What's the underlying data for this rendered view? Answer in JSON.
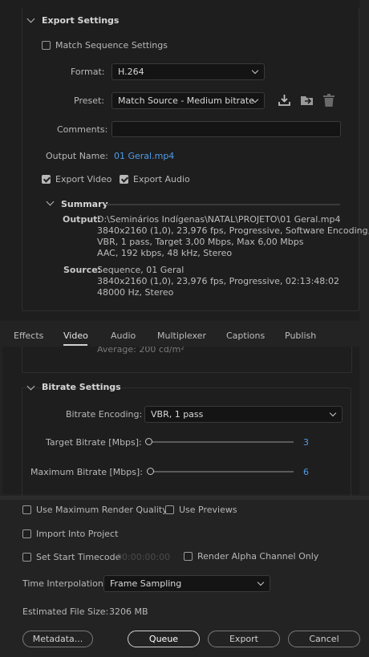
{
  "export_settings": {
    "header": "Export Settings",
    "match_sequence_label": "Match Sequence Settings",
    "match_sequence_checked": false,
    "format_label": "Format:",
    "format_value": "H.264",
    "preset_label": "Preset:",
    "preset_value": "Match Source - Medium bitrate",
    "preset_icons": [
      "save-preset-icon",
      "import-preset-icon",
      "delete-preset-icon"
    ],
    "comments_label": "Comments:",
    "comments_value": "",
    "output_name_label": "Output Name:",
    "output_name_value": "01 Geral.mp4",
    "export_video_label": "Export Video",
    "export_video_checked": true,
    "export_audio_label": "Export Audio",
    "export_audio_checked": true
  },
  "summary": {
    "header": "Summary",
    "output_label": "Output:",
    "output_lines": [
      "D:\\Seminários Indígenas\\NATAL\\PROJETO\\01 Geral.mp4",
      "3840x2160 (1,0), 23,976 fps, Progressive, Software Encoding,...",
      "VBR, 1 pass, Target 3,00 Mbps, Max 6,00 Mbps",
      "AAC, 192 kbps, 48 kHz, Stereo"
    ],
    "source_label": "Source:",
    "source_lines": [
      "Sequence, 01 Geral",
      "3840x2160 (1,0), 23,976 fps, Progressive, 02:13:48:02",
      "48000 Hz, Stereo"
    ]
  },
  "tabs": [
    {
      "label": "Effects",
      "active": false
    },
    {
      "label": "Video",
      "active": true
    },
    {
      "label": "Audio",
      "active": false
    },
    {
      "label": "Multiplexer",
      "active": false
    },
    {
      "label": "Captions",
      "active": false
    },
    {
      "label": "Publish",
      "active": false
    }
  ],
  "partial_text": "Average: 200 cd/m²",
  "bitrate_settings": {
    "header": "Bitrate Settings",
    "encoding_label": "Bitrate Encoding:",
    "encoding_value": "VBR, 1 pass",
    "target_label": "Target Bitrate [Mbps]:",
    "target_value": "3",
    "target_fraction": 0.0,
    "max_label": "Maximum Bitrate [Mbps]:",
    "max_value": "6",
    "max_fraction": 0.0
  },
  "bottom": {
    "use_max_render_label": "Use Maximum Render Quality",
    "use_max_render_checked": false,
    "use_previews_label": "Use Previews",
    "use_previews_checked": false,
    "import_project_label": "Import Into Project",
    "import_project_checked": false,
    "set_start_tc_label": "Set Start Timecode",
    "set_start_tc_checked": false,
    "start_tc_value": "00:00:00:00",
    "render_alpha_label": "Render Alpha Channel Only",
    "render_alpha_checked": false,
    "time_interp_label": "Time Interpolation:",
    "time_interp_value": "Frame Sampling",
    "est_size_label": "Estimated File Size:",
    "est_size_value": "3206 MB"
  },
  "buttons": {
    "metadata": "Metadata...",
    "queue": "Queue",
    "export": "Export",
    "cancel": "Cancel"
  },
  "colors": {
    "background": "#232323",
    "panel": "#1e1e1e",
    "accent": "#4f9ce8"
  }
}
